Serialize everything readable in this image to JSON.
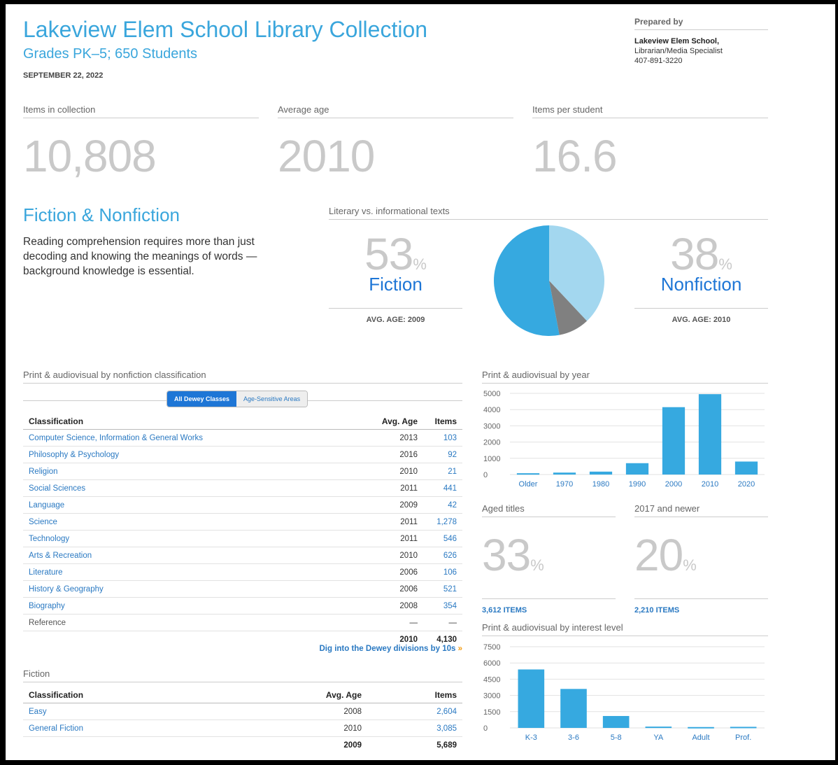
{
  "header": {
    "title": "Lakeview Elem School Library Collection",
    "subtitle": "Grades PK–5; 650 Students",
    "date": "SEPTEMBER 22, 2022"
  },
  "prepared": {
    "label": "Prepared by",
    "name": "Lakeview Elem School,",
    "role": "Librarian/Media Specialist",
    "phone": "407-891-3220"
  },
  "stats": [
    {
      "label": "Items in collection",
      "value": "10,808"
    },
    {
      "label": "Average age",
      "value": "2010"
    },
    {
      "label": "Items per student",
      "value": "16.6"
    }
  ],
  "fiction_section": {
    "title": "Fiction & Nonfiction",
    "body": "Reading comprehension requires more than just decoding and knowing the meanings of words — background knowledge is essential."
  },
  "literary": {
    "label": "Literary vs. informational texts",
    "fiction_pct": "53",
    "fiction_label": "Fiction",
    "fiction_age": "AVG. AGE: 2009",
    "nonfiction_pct": "38",
    "nonfiction_label": "Nonfiction",
    "nonfiction_age": "AVG. AGE: 2010",
    "pct_sign": "%",
    "colors": {
      "fiction": "#36a9e0",
      "nonfiction": "#a3d7ef",
      "other": "#808080"
    }
  },
  "nonfiction_table": {
    "label": "Print & audiovisual by nonfiction classification",
    "tabs": [
      "All Dewey Classes",
      "Age-Sensitive Areas"
    ],
    "headers": [
      "Classification",
      "Avg. Age",
      "Items"
    ],
    "rows": [
      [
        "Computer Science, Information & General Works",
        "2013",
        "103"
      ],
      [
        "Philosophy & Psychology",
        "2016",
        "92"
      ],
      [
        "Religion",
        "2010",
        "21"
      ],
      [
        "Social Sciences",
        "2011",
        "441"
      ],
      [
        "Language",
        "2009",
        "42"
      ],
      [
        "Science",
        "2011",
        "1,278"
      ],
      [
        "Technology",
        "2011",
        "546"
      ],
      [
        "Arts & Recreation",
        "2010",
        "626"
      ],
      [
        "Literature",
        "2006",
        "106"
      ],
      [
        "History & Geography",
        "2006",
        "521"
      ],
      [
        "Biography",
        "2008",
        "354"
      ],
      [
        "Reference",
        "—",
        "—"
      ]
    ],
    "total": [
      "",
      "2010",
      "4,130"
    ],
    "dig_link": "Dig into the Dewey divisions by 10s",
    "dig_arrow": "»"
  },
  "fiction_table": {
    "label": "Fiction",
    "headers": [
      "Classification",
      "Avg. Age",
      "Items"
    ],
    "rows": [
      [
        "Easy",
        "2008",
        "2,604"
      ],
      [
        "General Fiction",
        "2010",
        "3,085"
      ]
    ],
    "total": [
      "",
      "2009",
      "5,689"
    ]
  },
  "aged": {
    "aged_label": "Aged titles",
    "aged_pct": "33",
    "aged_items": "3,612 ITEMS",
    "newer_label": "2017 and newer",
    "newer_pct": "20",
    "newer_items": "2,210 ITEMS"
  },
  "chart_data": [
    {
      "type": "bar",
      "title": "Print & audiovisual by year",
      "categories": [
        "Older",
        "1970",
        "1980",
        "1990",
        "2000",
        "2010",
        "2020"
      ],
      "values": [
        80,
        120,
        180,
        700,
        4150,
        4950,
        800
      ],
      "ylim": [
        0,
        5000
      ],
      "yticks": [
        "0",
        "1000",
        "2000",
        "3000",
        "4000",
        "5000"
      ],
      "color": "#36a9e0",
      "grid": true
    },
    {
      "type": "bar",
      "title": "Print & audiovisual by interest level",
      "categories": [
        "K-3",
        "3-6",
        "5-8",
        "YA",
        "Adult",
        "Prof."
      ],
      "values": [
        5400,
        3600,
        1100,
        120,
        80,
        100
      ],
      "ylim": [
        0,
        7500
      ],
      "yticks": [
        "0",
        "1500",
        "3000",
        "4500",
        "6000",
        "7500"
      ],
      "color": "#36a9e0",
      "grid": true
    }
  ]
}
